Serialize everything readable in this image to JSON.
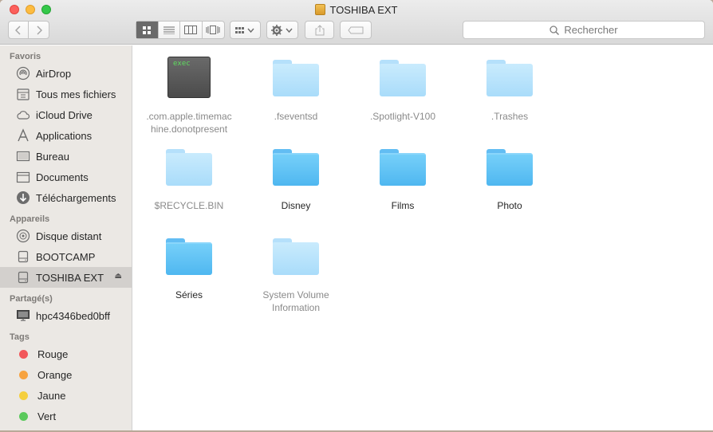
{
  "window": {
    "title": "TOSHIBA EXT"
  },
  "toolbar": {
    "search_placeholder": "Rechercher"
  },
  "sidebar": {
    "favorites_header": "Favoris",
    "favorites": [
      {
        "label": "AirDrop",
        "icon": "airdrop-icon"
      },
      {
        "label": "Tous mes fichiers",
        "icon": "all-files-icon"
      },
      {
        "label": "iCloud Drive",
        "icon": "cloud-icon"
      },
      {
        "label": "Applications",
        "icon": "applications-icon"
      },
      {
        "label": "Bureau",
        "icon": "desktop-icon"
      },
      {
        "label": "Documents",
        "icon": "documents-icon"
      },
      {
        "label": "Téléchargements",
        "icon": "downloads-icon"
      }
    ],
    "devices_header": "Appareils",
    "devices": [
      {
        "label": "Disque distant",
        "icon": "disc-icon"
      },
      {
        "label": "BOOTCAMP",
        "icon": "drive-icon"
      },
      {
        "label": "TOSHIBA EXT",
        "icon": "drive-icon",
        "selected": true
      }
    ],
    "shared_header": "Partagé(s)",
    "shared": [
      {
        "label": "hpc4346bed0bff",
        "icon": "computer-icon"
      }
    ],
    "tags_header": "Tags",
    "tags": [
      {
        "label": "Rouge",
        "color": "#f2575a"
      },
      {
        "label": "Orange",
        "color": "#f7a340"
      },
      {
        "label": "Jaune",
        "color": "#f5cf3e"
      },
      {
        "label": "Vert",
        "color": "#5bc95c"
      }
    ]
  },
  "files": [
    {
      "name": ".com.apple.timemachine.donotpresent",
      "line1": ".com.apple.timemac",
      "line2": "hine.donotpresent",
      "type": "exec",
      "hidden": true,
      "exec_label": "exec"
    },
    {
      "name": ".fseventsd",
      "type": "folder",
      "hidden": true
    },
    {
      "name": ".Spotlight-V100",
      "type": "folder",
      "hidden": true
    },
    {
      "name": ".Trashes",
      "type": "folder",
      "hidden": true
    },
    {
      "name": "$RECYCLE.BIN",
      "type": "folder",
      "hidden": true
    },
    {
      "name": "Disney",
      "type": "folder",
      "hidden": false
    },
    {
      "name": "Films",
      "type": "folder",
      "hidden": false
    },
    {
      "name": "Photo",
      "type": "folder",
      "hidden": false
    },
    {
      "name": "Séries",
      "type": "folder",
      "hidden": false
    },
    {
      "name": "System Volume Information",
      "line1": "System Volume",
      "line2": "Information",
      "type": "folder",
      "hidden": true
    }
  ]
}
